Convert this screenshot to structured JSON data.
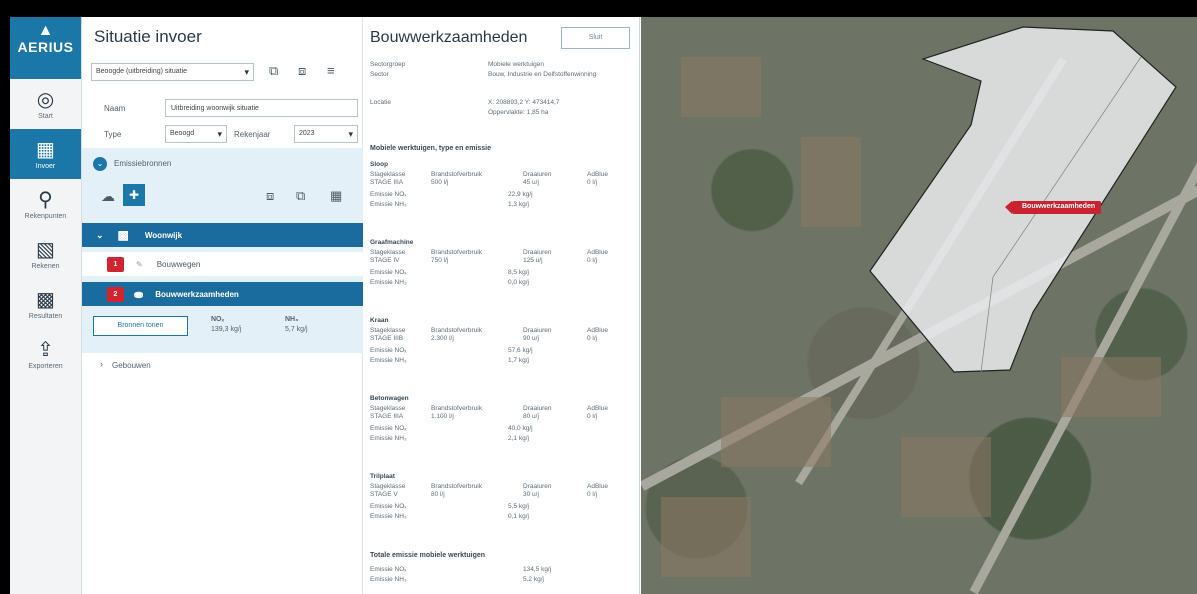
{
  "app": {
    "logo_text": "AERIUS"
  },
  "nav": [
    {
      "id": "start",
      "label": "Start",
      "icon": "target-icon"
    },
    {
      "id": "invoer",
      "label": "Invoer",
      "icon": "clipboard-icon",
      "active": true
    },
    {
      "id": "rekenpunten",
      "label": "Rekenpunten",
      "icon": "location-pin-icon"
    },
    {
      "id": "rekenen",
      "label": "Rekenen",
      "icon": "calculator-icon"
    },
    {
      "id": "resultaten",
      "label": "Resultaten",
      "icon": "bar-chart-icon"
    },
    {
      "id": "exporteren",
      "label": "Exporteren",
      "icon": "export-icon"
    }
  ],
  "situation": {
    "title": "Situatie invoer",
    "situation_select": "Beoogde (uitbreiding) situatie",
    "name_label": "Naam",
    "name_value": "Uitbreiding woonwijk situatie",
    "type_label": "Type",
    "type_value": "Beoogd",
    "year_label": "Rekenjaar",
    "year_value": "2023",
    "sources_toggle": "Emissiebronnen",
    "rows": [
      {
        "kind": "group",
        "label": "Woonwijk",
        "expanded": true
      },
      {
        "kind": "source",
        "badge": "1",
        "label": "Bouwwegen",
        "selected": false
      },
      {
        "kind": "source",
        "badge": "2",
        "label": "Bouwwerkzaamheden",
        "selected": true
      }
    ],
    "totals_button": "Bronnen tonen",
    "totals": [
      {
        "label": "NOₓ",
        "value": "139,3 kg/j"
      },
      {
        "label": "NH₃",
        "value": "5,7 kg/j"
      }
    ],
    "buildings_toggle": "Gebouwen"
  },
  "detail": {
    "title": "Bouwwerkzaamheden",
    "close_label": "Sluit",
    "meta": [
      {
        "label": "Sectorgroep",
        "value": "Mobiele werktuigen"
      },
      {
        "label": "Sector",
        "value": "Bouw, Industrie en Delfstoffenwinning"
      },
      {
        "label": "Locatie",
        "value": "X: 208893,2 Y: 473414,7"
      },
      {
        "label": "",
        "value": "Oppervlakte: 1,85 ha"
      }
    ],
    "section_title": "Mobiele werktuigen, type en emissie",
    "col_labels": [
      "Stageklasse",
      "Brandstofverbruik",
      "Draaiuren",
      "AdBlue"
    ],
    "items": [
      {
        "name": "Sloop",
        "stage": "STAGE IIIA",
        "fuel": "500 l/j",
        "hours": "45 u/j",
        "adblue": "0 l/j",
        "nox": "22,9 kg/j",
        "nh3": "1,3 kg/j"
      },
      {
        "name": "Graafmachine",
        "stage": "STAGE IV",
        "fuel": "750 l/j",
        "hours": "125 u/j",
        "adblue": "0 l/j",
        "nox": "8,5 kg/j",
        "nh3": "0,0 kg/j"
      },
      {
        "name": "Kraan",
        "stage": "STAGE IIIB",
        "fuel": "2.300 l/j",
        "hours": "90 u/j",
        "adblue": "0 l/j",
        "nox": "57,6 kg/j",
        "nh3": "1,7 kg/j"
      },
      {
        "name": "Betonwagen",
        "stage": "STAGE IIIA",
        "fuel": "1.100 l/j",
        "hours": "80 u/j",
        "adblue": "0 l/j",
        "nox": "40,0 kg/j",
        "nh3": "2,1 kg/j"
      },
      {
        "name": "Trilplaat",
        "stage": "STAGE V",
        "fuel": "80 l/j",
        "hours": "30 u/j",
        "adblue": "0 l/j",
        "nox": "5,5 kg/j",
        "nh3": "0,1 kg/j"
      }
    ],
    "emission_nox_label": "Emissie NOₓ",
    "emission_nh3_label": "Emissie NH₃",
    "total_title": "Totale emissie mobiele werktuigen",
    "total_nox": "134,5 kg/j",
    "total_nh3": "5,2 kg/j"
  },
  "map": {
    "label": "Bouwwerkzaamheden"
  }
}
